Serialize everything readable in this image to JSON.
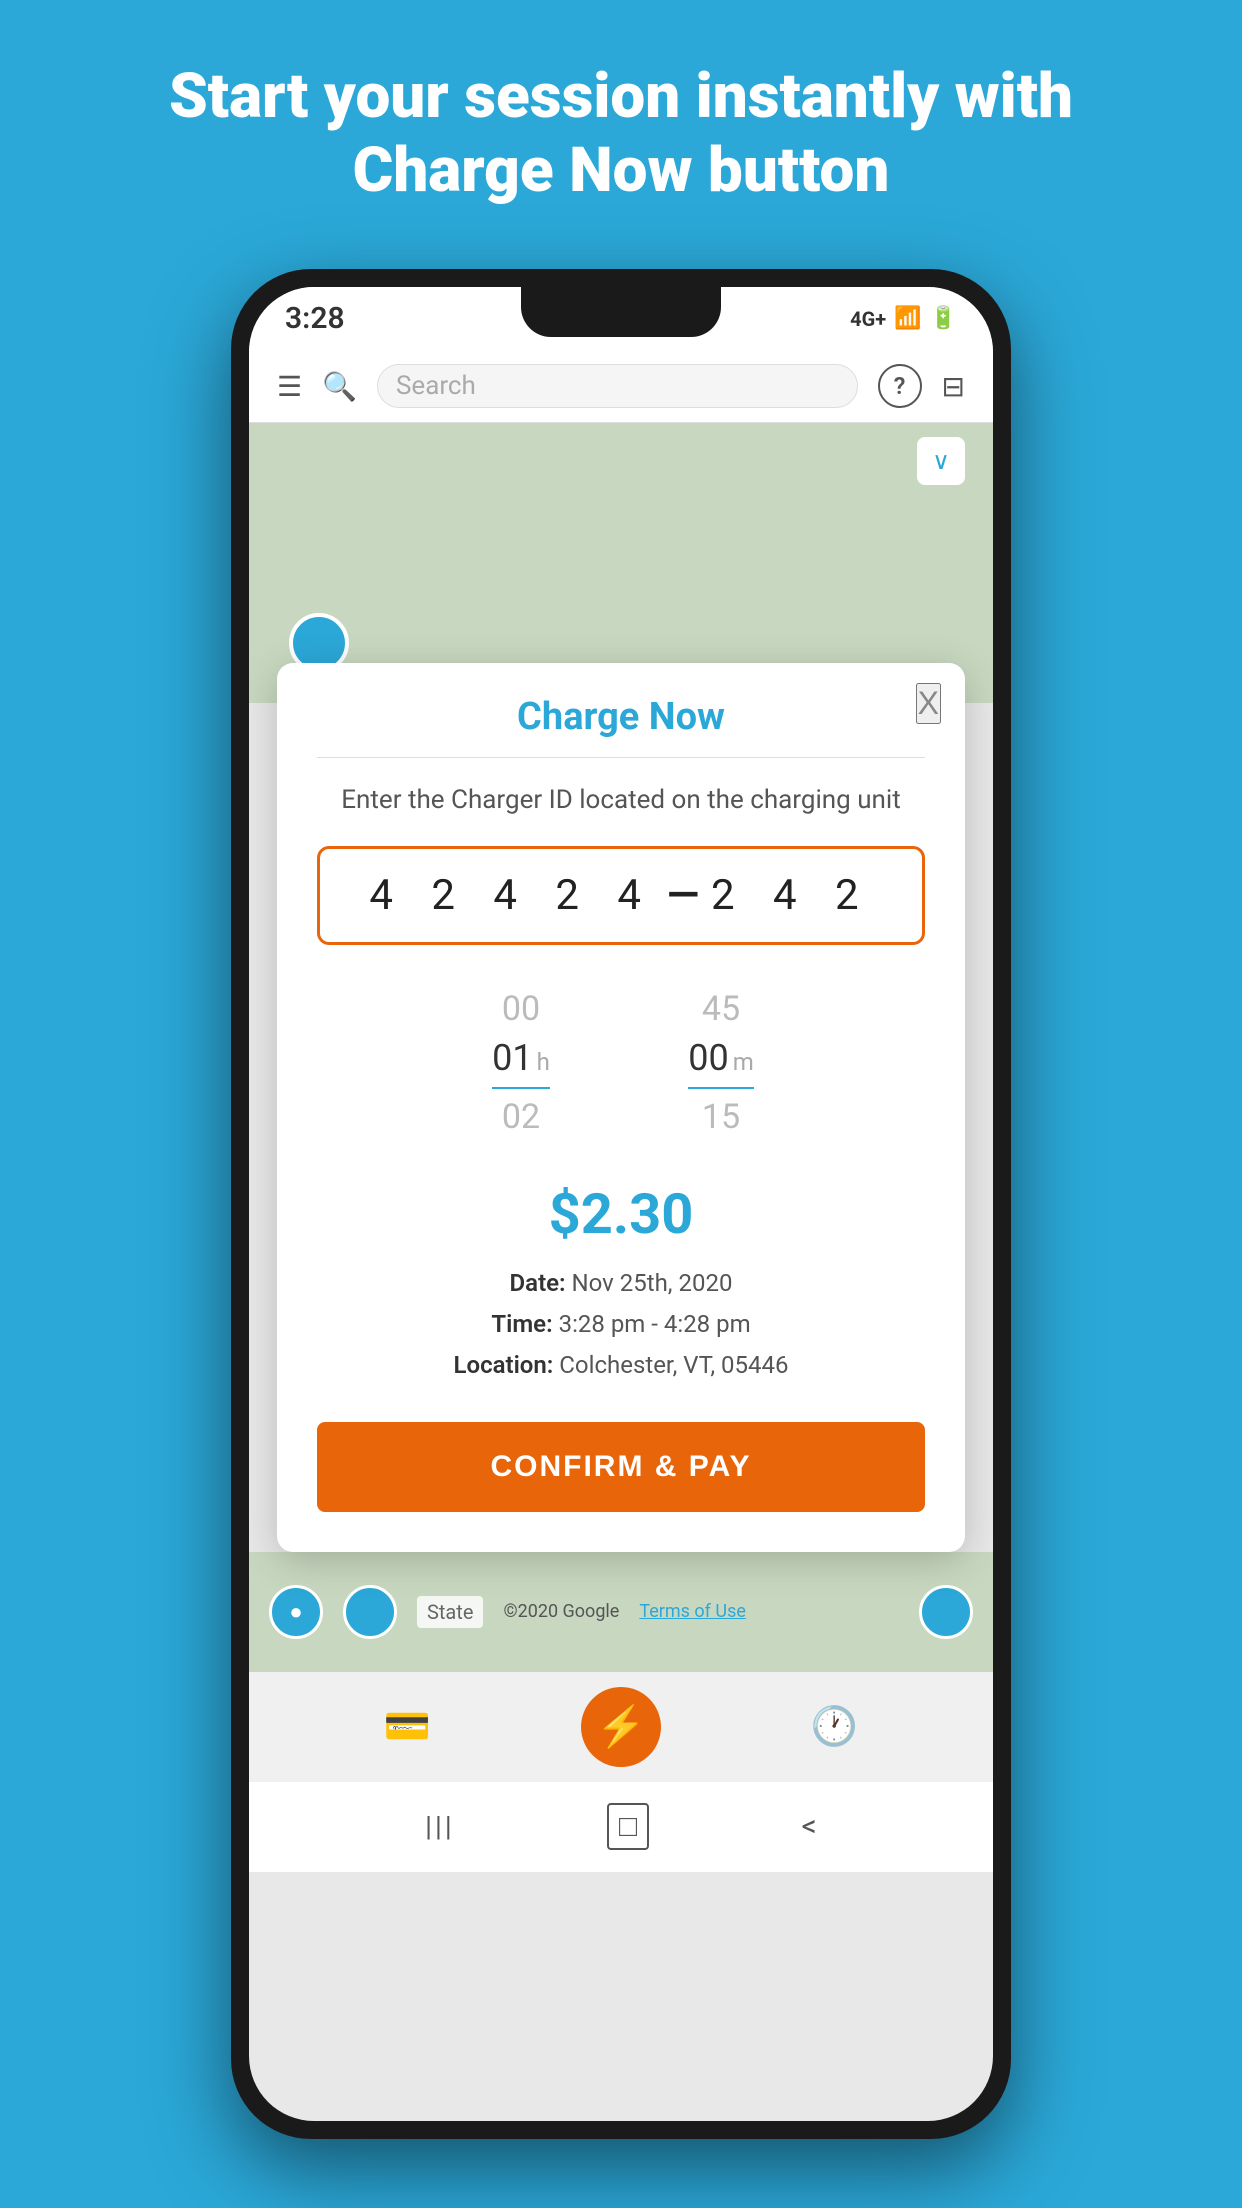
{
  "header": {
    "line1": "Start your session instantly with",
    "line2": "Charge Now button"
  },
  "status_bar": {
    "time": "3:28",
    "network": "4G+",
    "battery": "▮"
  },
  "navbar": {
    "search_placeholder": "Search",
    "help_icon": "?",
    "filter_icon": "≡"
  },
  "modal": {
    "title": "Charge Now",
    "close_label": "X",
    "description": "Enter the Charger ID located on the charging unit",
    "charger_id_left": "4 2 4 2 4",
    "charger_id_dash": "—",
    "charger_id_right": "2 4 2",
    "time_picker": {
      "hours_above": "00",
      "hours_selected": "01",
      "hours_unit": "h",
      "hours_below": "02",
      "minutes_above": "45",
      "minutes_selected": "00",
      "minutes_unit": "m",
      "minutes_below": "15"
    },
    "price": "$2.30",
    "date_label": "Date:",
    "date_value": "Nov 25th, 2020",
    "time_label": "Time:",
    "time_value": "3:28 pm - 4:28 pm",
    "location_label": "Location:",
    "location_value": "Colchester, VT, 05446",
    "confirm_button": "CONFIRM & PAY"
  },
  "bottom_map": {
    "label": "State"
  },
  "bottom_tabs": {
    "payments_icon": "💳",
    "charge_icon": "⚡",
    "history_icon": "🕐"
  },
  "android_nav": {
    "menu_icon": "|||",
    "home_icon": "□",
    "back_icon": "<"
  }
}
